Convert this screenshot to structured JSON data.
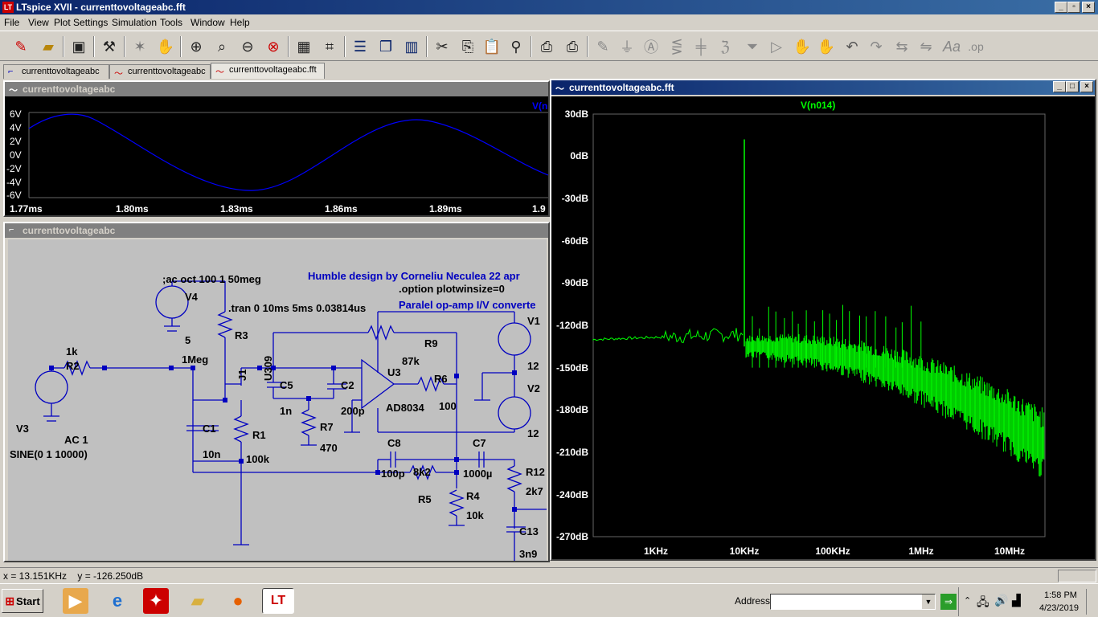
{
  "app": {
    "title": "LTspice XVII - currenttovoltageabc.fft"
  },
  "menu": [
    "File",
    "View",
    "Plot Settings",
    "Simulation",
    "Tools",
    "Window",
    "Help"
  ],
  "tabs": [
    {
      "label": "currenttovoltageabc",
      "kind": "schematic"
    },
    {
      "label": "currenttovoltageabc",
      "kind": "waveform"
    },
    {
      "label": "currenttovoltageabc.fft",
      "kind": "waveform",
      "active": true
    }
  ],
  "wave_window": {
    "title": "currenttovoltageabc",
    "trace_label": "V(n",
    "y_ticks": [
      "6V",
      "4V",
      "2V",
      "0V",
      "-2V",
      "-4V",
      "-6V"
    ],
    "x_ticks": [
      "1.77ms",
      "1.80ms",
      "1.83ms",
      "1.86ms",
      "1.89ms",
      "1.9"
    ],
    "trace_color": "#0000ff"
  },
  "schematic_window": {
    "title": "currenttovoltageabc",
    "directives": {
      "ac": ";ac oct 100 1 50meg",
      "tran": ".tran 0 10ms 5ms 0.03814us",
      "credit": "Humble design by Corneliu Neculea 22 apr",
      "option": ".option plotwinsize=0",
      "desc": "Paralel op-amp I/V converte"
    },
    "labels": {
      "v4": "V4",
      "v4_val": "5",
      "r3": "R3",
      "r3_val": "1Meg",
      "j1": "J1",
      "u309": "U309",
      "r2_val": "1k",
      "r2": "R2",
      "v3": "V3",
      "v3_ac": "AC 1",
      "v3_sine": "SINE(0 1 10000)",
      "c1": "C1",
      "c1_val": "10n",
      "r1": "R1",
      "r1_val": "100k",
      "c5": "C5",
      "c5_val": "1n",
      "c2": "C2",
      "c2_val": "200p",
      "r7": "R7",
      "r7_val": "470",
      "r9": "R9",
      "r9_val": "87k",
      "u3": "U3",
      "u3_val": "AD8034",
      "r6": "R6",
      "r6_val": "100",
      "v1": "V1",
      "v1_val": "12",
      "v2": "V2",
      "v2_val": "12",
      "c8": "C8",
      "c8_val": "100p",
      "r5_val": "8k2",
      "r5": "R5",
      "c7": "C7",
      "c7_val": "1000µ",
      "r4": "R4",
      "r4_val": "10k",
      "r12": "R12",
      "r12_val": "2k7",
      "c13": "C13",
      "c13_val": "3n9"
    }
  },
  "fft_window": {
    "title": "currenttovoltageabc.fft",
    "trace_label": "V(n014)",
    "trace_color": "#00ff00",
    "y_ticks": [
      "30dB",
      "0dB",
      "-30dB",
      "-60dB",
      "-90dB",
      "-120dB",
      "-150dB",
      "-180dB",
      "-210dB",
      "-240dB",
      "-270dB"
    ],
    "x_ticks": [
      "1KHz",
      "10KHz",
      "100KHz",
      "1MHz",
      "10MHz"
    ]
  },
  "status": {
    "cursor": "x = 13.151KHz    y = -126.250dB"
  },
  "taskbar": {
    "start_label": "Start",
    "address_label": "Address",
    "time": "1:58 PM",
    "date": "4/23/2019"
  }
}
